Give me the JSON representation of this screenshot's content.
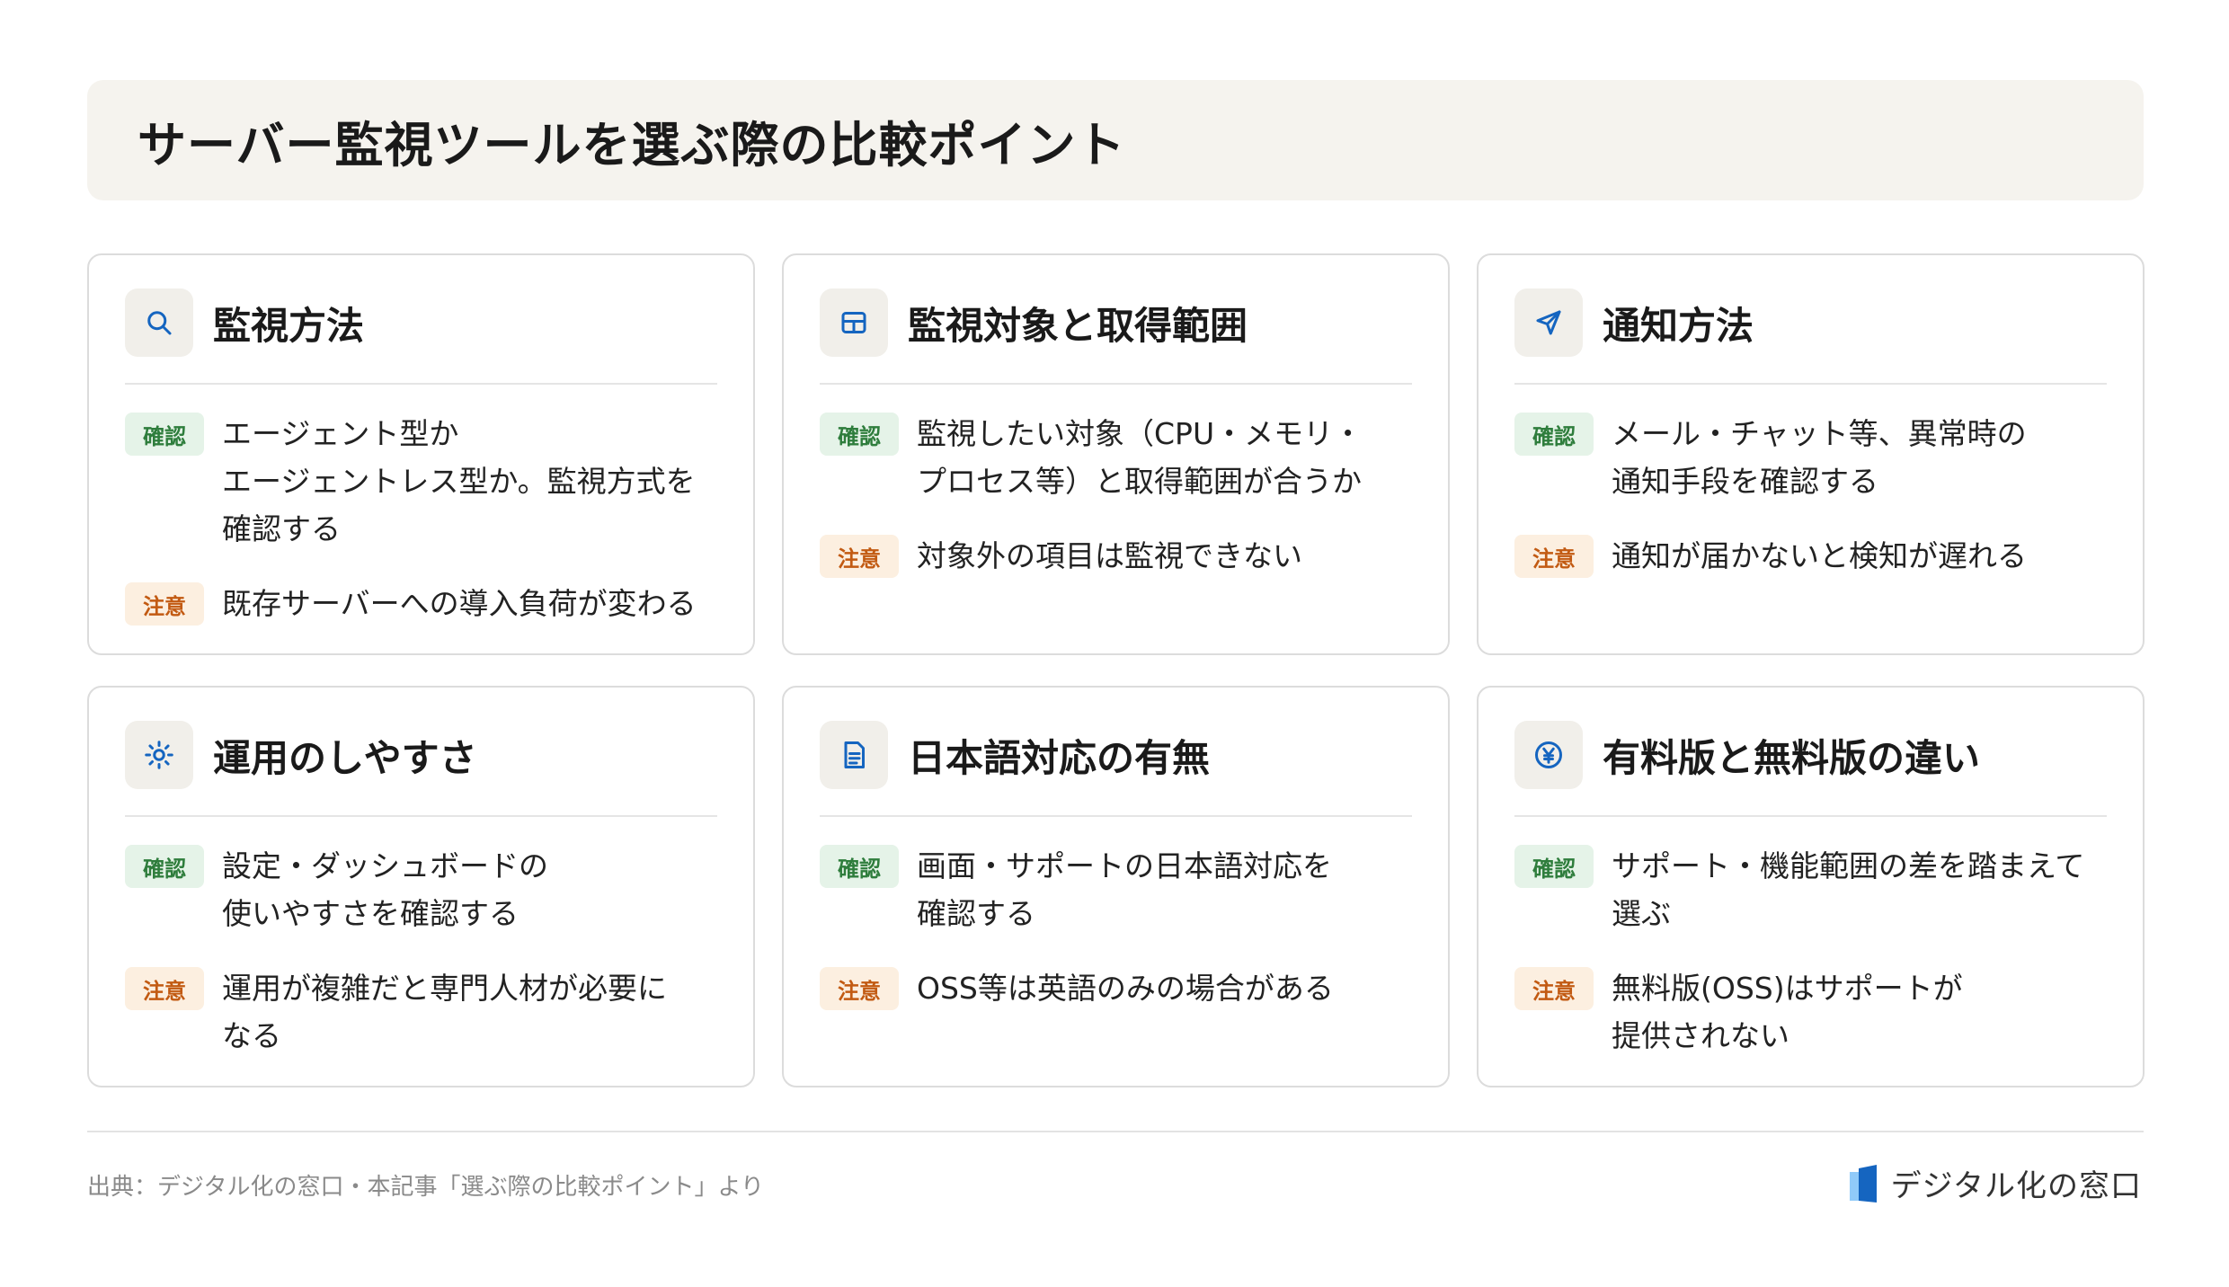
{
  "title": "サーバー監視ツールを選ぶ際の比較ポイント",
  "badges": {
    "confirm": "確認",
    "caution": "注意"
  },
  "cards": [
    {
      "icon": "search-icon",
      "title": "監視方法",
      "confirm": "エージェント型か\nエージェントレス型か。監視方式を\n確認する",
      "caution": "既存サーバーへの導入負荷が変わる"
    },
    {
      "icon": "grid-icon",
      "title": "監視対象と取得範囲",
      "confirm": "監視したい対象（CPU・メモリ・\nプロセス等）と取得範囲が合うか",
      "caution": "対象外の項目は監視できない"
    },
    {
      "icon": "send-icon",
      "title": "通知方法",
      "confirm": "メール・チャット等、異常時の\n通知手段を確認する",
      "caution": "通知が届かないと検知が遅れる"
    },
    {
      "icon": "sun-icon",
      "title": "運用のしやすさ",
      "confirm": "設定・ダッシュボードの\n使いやすさを確認する",
      "caution": "運用が複雑だと専門人材が必要に\nなる"
    },
    {
      "icon": "document-icon",
      "title": "日本語対応の有無",
      "confirm": "画面・サポートの日本語対応を\n確認する",
      "caution": "OSS等は英語のみの場合がある"
    },
    {
      "icon": "yen-icon",
      "title": "有料版と無料版の違い",
      "confirm": "サポート・機能範囲の差を踏まえて\n選ぶ",
      "caution": "無料版(OSS)はサポートが\n提供されない"
    }
  ],
  "footer": {
    "source": "出典：デジタル化の窓口・本記事「選ぶ際の比較ポイント」より",
    "brand": "デジタル化の窓口"
  },
  "colors": {
    "accent": "#1565c0",
    "confirm_bg": "#e5f3e8",
    "confirm_text": "#2e7d3c",
    "caution_bg": "#fcefe0",
    "caution_text": "#c25a12"
  }
}
